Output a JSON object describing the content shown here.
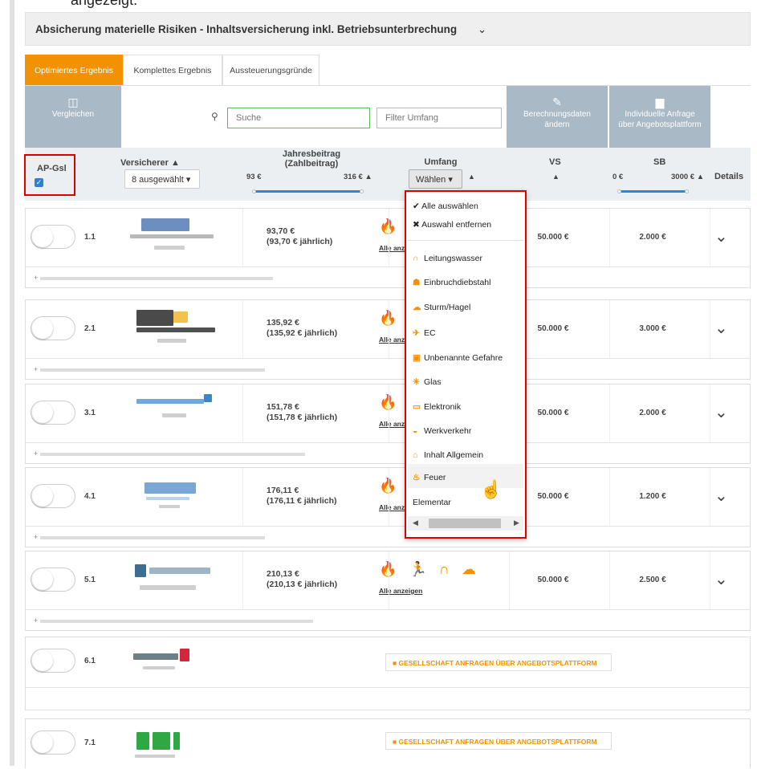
{
  "top_text": "angezeigt.",
  "panel": {
    "title": "Absicherung materielle Risiken - Inhaltsversicherung inkl. Betriebsunterbrechung",
    "chevron": "⌄"
  },
  "tabs": [
    "Optimiertes Ergebnis",
    "Komplettes Ergebnis",
    "Aussteuerungsgründe"
  ],
  "toolbar": {
    "compare": "Vergleichen",
    "search_placeholder": "Suche",
    "filter_placeholder": "Filter Umfang",
    "berechnung_line1": "Berechnungsdaten",
    "berechnung_line2": "ändern",
    "anfrage_line1": "Individuelle Anfrage",
    "anfrage_line2": "über Angebotsplattform"
  },
  "header": {
    "ap_gsl": "AP-Gsl",
    "versicherer": "Versicherer ▲",
    "versicherer_select": "8 ausgewählt ▾",
    "jahresbeitrag_line1": "Jahresbeitrag",
    "jahresbeitrag_line2": "(Zahlbeitrag)",
    "jb_min": "93 €",
    "jb_max": "316 € ▲",
    "umfang": "Umfang",
    "umfang_select": "Wählen ▾",
    "umfang_arrow": "▲",
    "vs": "VS",
    "vs_arrow": "▲",
    "sb": "SB",
    "sb_min": "0 €",
    "sb_max": "3000 € ▲",
    "details": "Details"
  },
  "dropdown": {
    "select_all": "Alle auswählen",
    "remove": "Auswahl entfernen",
    "items": [
      "Leitungswasser",
      "Einbruchdiebstahl",
      "Sturm/Hagel",
      "EC",
      "Unbenannte Gefahre",
      "Glas",
      "Elektronik",
      "Werkverkehr",
      "Inhalt Allgemein",
      "Feuer",
      "Elementar"
    ],
    "icons": [
      "faucet-icon",
      "burglar-icon",
      "storm-icon",
      "ec-icon",
      "unnamed-danger-icon",
      "glass-icon",
      "electronics-icon",
      "car-icon",
      "house-icon",
      "fire-icon",
      ""
    ]
  },
  "results": [
    {
      "rank": "1.1",
      "price": "93,70 €",
      "price_year": "(93,70 € jährlich)",
      "vs": "50.000 €",
      "sb": "2.000 €",
      "alle": "Alle anze"
    },
    {
      "rank": "2.1",
      "price": "135,92 €",
      "price_year": "(135,92 € jährlich)",
      "vs": "50.000 €",
      "sb": "3.000 €",
      "alle": "Alle anze"
    },
    {
      "rank": "3.1",
      "price": "151,78 €",
      "price_year": "(151,78 € jährlich)",
      "vs": "50.000 €",
      "sb": "2.000 €",
      "alle": "Alle anze"
    },
    {
      "rank": "4.1",
      "price": "176,11 €",
      "price_year": "(176,11 € jährlich)",
      "vs": "50.000 €",
      "sb": "1.200 €",
      "alle": "Alle anze"
    },
    {
      "rank": "5.1",
      "price": "210,13 €",
      "price_year": "(210,13 € jährlich)",
      "vs": "50.000 €",
      "sb": "2.500 €",
      "alle": "Alle anzeigen"
    },
    {
      "rank": "6.1",
      "anfrage": "GESELLSCHAFT ANFRAGEN ÜBER ANGEBOTSPLATTFORM"
    },
    {
      "rank": "7.1",
      "anfrage": "GESELLSCHAFT ANFRAGEN ÜBER ANGEBOTSPLATTFORM"
    }
  ],
  "colors": {
    "accent": "#f39200",
    "toolbar": "#a9b9c6",
    "highlight": "#d00000"
  }
}
